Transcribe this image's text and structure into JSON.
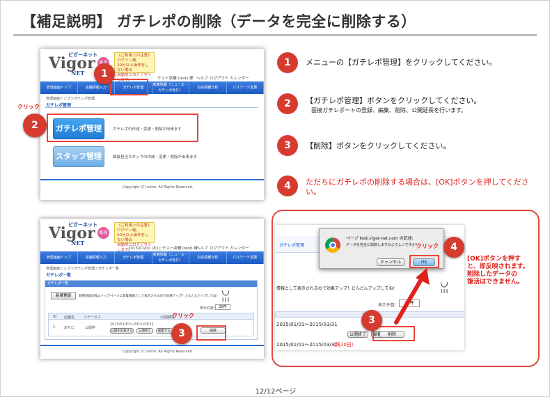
{
  "title": "【補足説明】 ガチレポの削除（データを完全に削除する）",
  "footer": "12/12ページ",
  "steps": [
    {
      "num": "1",
      "text": "メニューの【ガチレポ管理】をクリックしてください。"
    },
    {
      "num": "2",
      "text": "【ガチレポ管理】ボタンをクリックしてください。",
      "sub": "面接ガチレポートの登録、編集、削除、公開延長を行います。"
    },
    {
      "num": "3",
      "text": "【削除】ボタンをクリックしてください。"
    },
    {
      "num": "4",
      "text": "ただちにガチレポの削除する場合は、[OK]ボタンを押してください。"
    }
  ],
  "click_label": "クリック",
  "shot1": {
    "logo": "Vigor",
    "logo_net": "NET",
    "logo_top": "ビガーネット",
    "badge": "販売会",
    "notice_title": "《ご利用上の注意》",
    "notice_lines": [
      "ログイン後、",
      "30分以上操作をしない場合",
      "自動的にログアウトします。"
    ],
    "user_line": "テスト店舗 (test) 様",
    "links": [
      "ヘルプ",
      "ログアウト",
      "カレンダー"
    ],
    "nav": [
      "管理画面トップ",
      "店舗情報入力",
      "ガチレポ管理",
      "新着情報（ニュース・ガチレポ含む）",
      "お店情報分析",
      "パスワード変更"
    ],
    "breadcrumb": "管理画面トップ＞ガチレポ管理",
    "section": "ガチレポ管理",
    "btn1": "ガチレポ管理",
    "btn1_desc": "ガチレポの作成・変更・削除が出来ます",
    "btn2": "スタッフ管理",
    "btn2_desc": "面接担当スタッフの作成・変更・削除が出来ます",
    "copyright": "Copyright (C) entre. All Rights Reserved."
  },
  "shot2": {
    "date_line": "2015/01/01 (木) | テスト店舗 (test) 様",
    "breadcrumb": "管理画面トップ＞ガチレポ管理＞ガチレポ一覧",
    "section": "ガチレポ一覧",
    "panel_title": "ガチレポ一覧",
    "new_btn": "新規登録",
    "new_desc": "新規登録の後はトップページに新着情報として表示されるので効果アップ！どんどんアップしてね！",
    "count_label": "表示件数：",
    "count_value": "20件",
    "cols": [
      "ID",
      "店舗名",
      "ステータス",
      "公開期間"
    ],
    "row": [
      "1",
      "ありに",
      "公開中",
      "2015/01/01～2015/03/31"
    ],
    "row_btns": [
      "公開を延長する",
      "公開終了",
      "編集する",
      "削除"
    ],
    "copyright": "Copyright (C) entre. All Rights Reserved."
  },
  "shot3": {
    "nav": "ガチレポ管理",
    "dialog_title": "ページ test.vigor-net.com の記述:",
    "dialog_msg": "データを完全に削除しますがよろしいですか？",
    "cancel": "キャンセル",
    "ok": "OK",
    "bg_text": "情報として表示されるので効果アップ！どんどんアップしてね！",
    "count_label": "表示件数：",
    "count_value": "20件",
    "col": "公開期間",
    "period": "2015/01/01～2015/03/31",
    "period2": "2015/01/01～2015/03/31",
    "remain": "（残10日）",
    "btns": [
      "公開終了",
      "編集する",
      "削除"
    ],
    "note": [
      "[OK]ボタンを押す",
      "と、即反映されます。",
      "削除したデータの",
      "復活はできません。"
    ]
  },
  "colors": {
    "accent_red": "#d63b2f",
    "nav_blue": "#1c5ac2"
  }
}
